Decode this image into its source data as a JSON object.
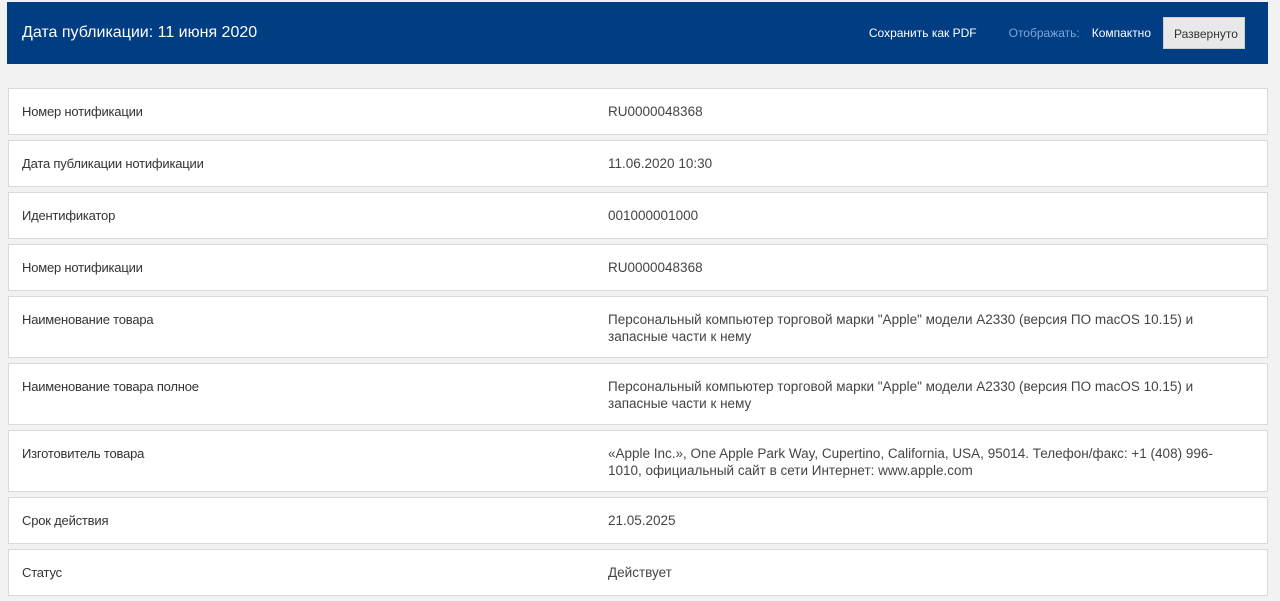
{
  "header": {
    "title": "Дата публикации: 11 июня 2020",
    "save_pdf_label": "Сохранить как PDF",
    "view_label": "Отображать:",
    "compact_label": "Компактно",
    "expanded_label": "Развернуто"
  },
  "rows": [
    {
      "label": "Номер нотификации",
      "value": "RU0000048368"
    },
    {
      "label": "Дата публикации нотификации",
      "value": "11.06.2020 10:30"
    },
    {
      "label": "Идентификатор",
      "value": "001000001000"
    },
    {
      "label": "Номер нотификации",
      "value": "RU0000048368"
    },
    {
      "label": "Наименование товара",
      "value": "Персональный компьютер торговой марки \"Apple\" модели A2330 (версия ПО macOS 10.15) и запасные части к нему"
    },
    {
      "label": "Наименование товара полное",
      "value": "Персональный компьютер торговой марки \"Apple\" модели A2330 (версия ПО macOS 10.15) и запасные части к нему"
    },
    {
      "label": "Изготовитель товара",
      "value": "«Apple Inc.», One Apple Park Way, Cupertino, California, USA, 95014. Телефон/факс: +1 (408) 996-1010, официальный сайт в сети Интернет: www.apple.com"
    },
    {
      "label": "Срок действия",
      "value": "21.05.2025"
    },
    {
      "label": "Статус",
      "value": "Действует"
    }
  ],
  "colors": {
    "header_bg": "#003d82",
    "page_bg": "#f2f2f2",
    "view_label": "#7aa7d8"
  }
}
